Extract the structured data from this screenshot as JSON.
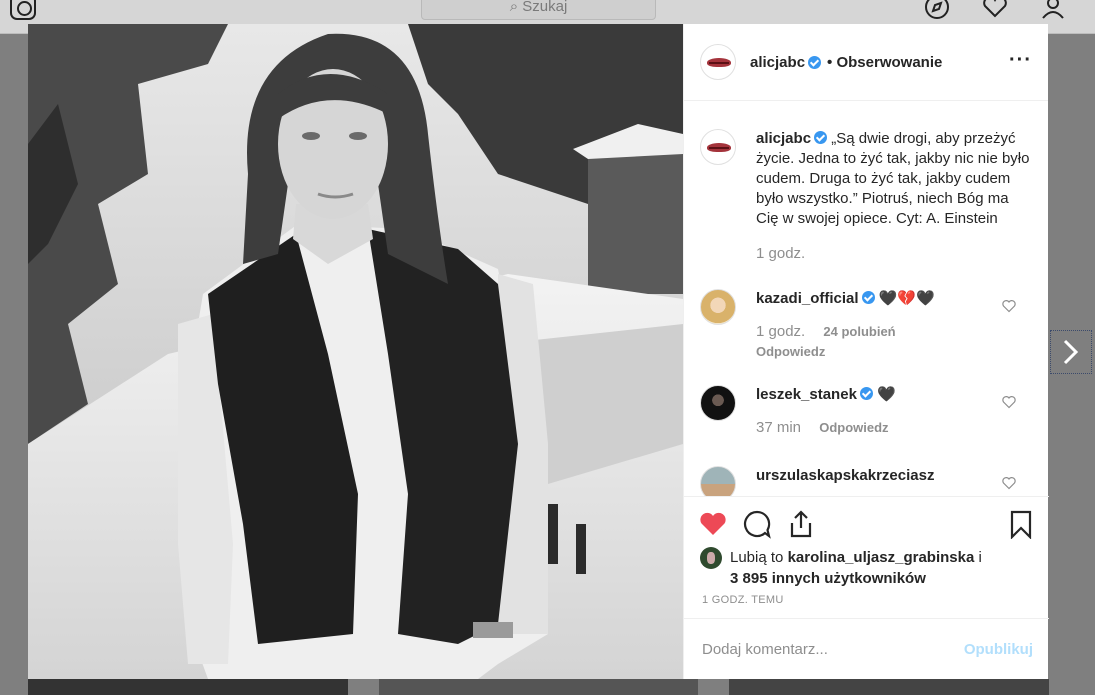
{
  "topbar": {
    "search_placeholder": "Szukaj",
    "icons": [
      "instagram-logo-icon",
      "search-icon",
      "compass-icon",
      "heart-icon",
      "user-icon"
    ]
  },
  "post": {
    "author": {
      "username": "alicjabc",
      "verified": true,
      "follow_status": "• Obserwowanie"
    },
    "more_icon": "···",
    "caption": {
      "username": "alicjabc",
      "text": "„Są dwie drogi, aby przeżyć życie. Jedna to żyć tak, jakby nic nie było cudem. Druga to żyć tak, jakby cudem było wszystko.” Piotruś, niech Bóg ma Cię w swojej opiece. Cyt: A. Einstein",
      "time": "1 godz."
    },
    "comments": [
      {
        "username": "kazadi_official",
        "verified": true,
        "text": "🖤💔🖤",
        "time": "1 godz.",
        "likes": "24 polubień",
        "reply": "Odpowiedz"
      },
      {
        "username": "leszek_stanek",
        "verified": true,
        "text": "🖤",
        "time": "37 min",
        "reply": "Odpowiedz"
      },
      {
        "username": "urszulaskapskakrzeciasz",
        "verified": false,
        "text": ""
      }
    ],
    "likes_summary": {
      "prefix": "Lubią to",
      "liker": "karolina_uljasz_grabinska",
      "joiner": "i",
      "others": "3 895 innych użytkowników"
    },
    "posted_ago": "1 GODZ. TEMU",
    "add_comment_placeholder": "Dodaj komentarz...",
    "publish_label": "Opublikuj"
  },
  "colors": {
    "heart": "#ed4956",
    "verified": "#3897f0",
    "publish_disabled": "#b2dffc"
  }
}
